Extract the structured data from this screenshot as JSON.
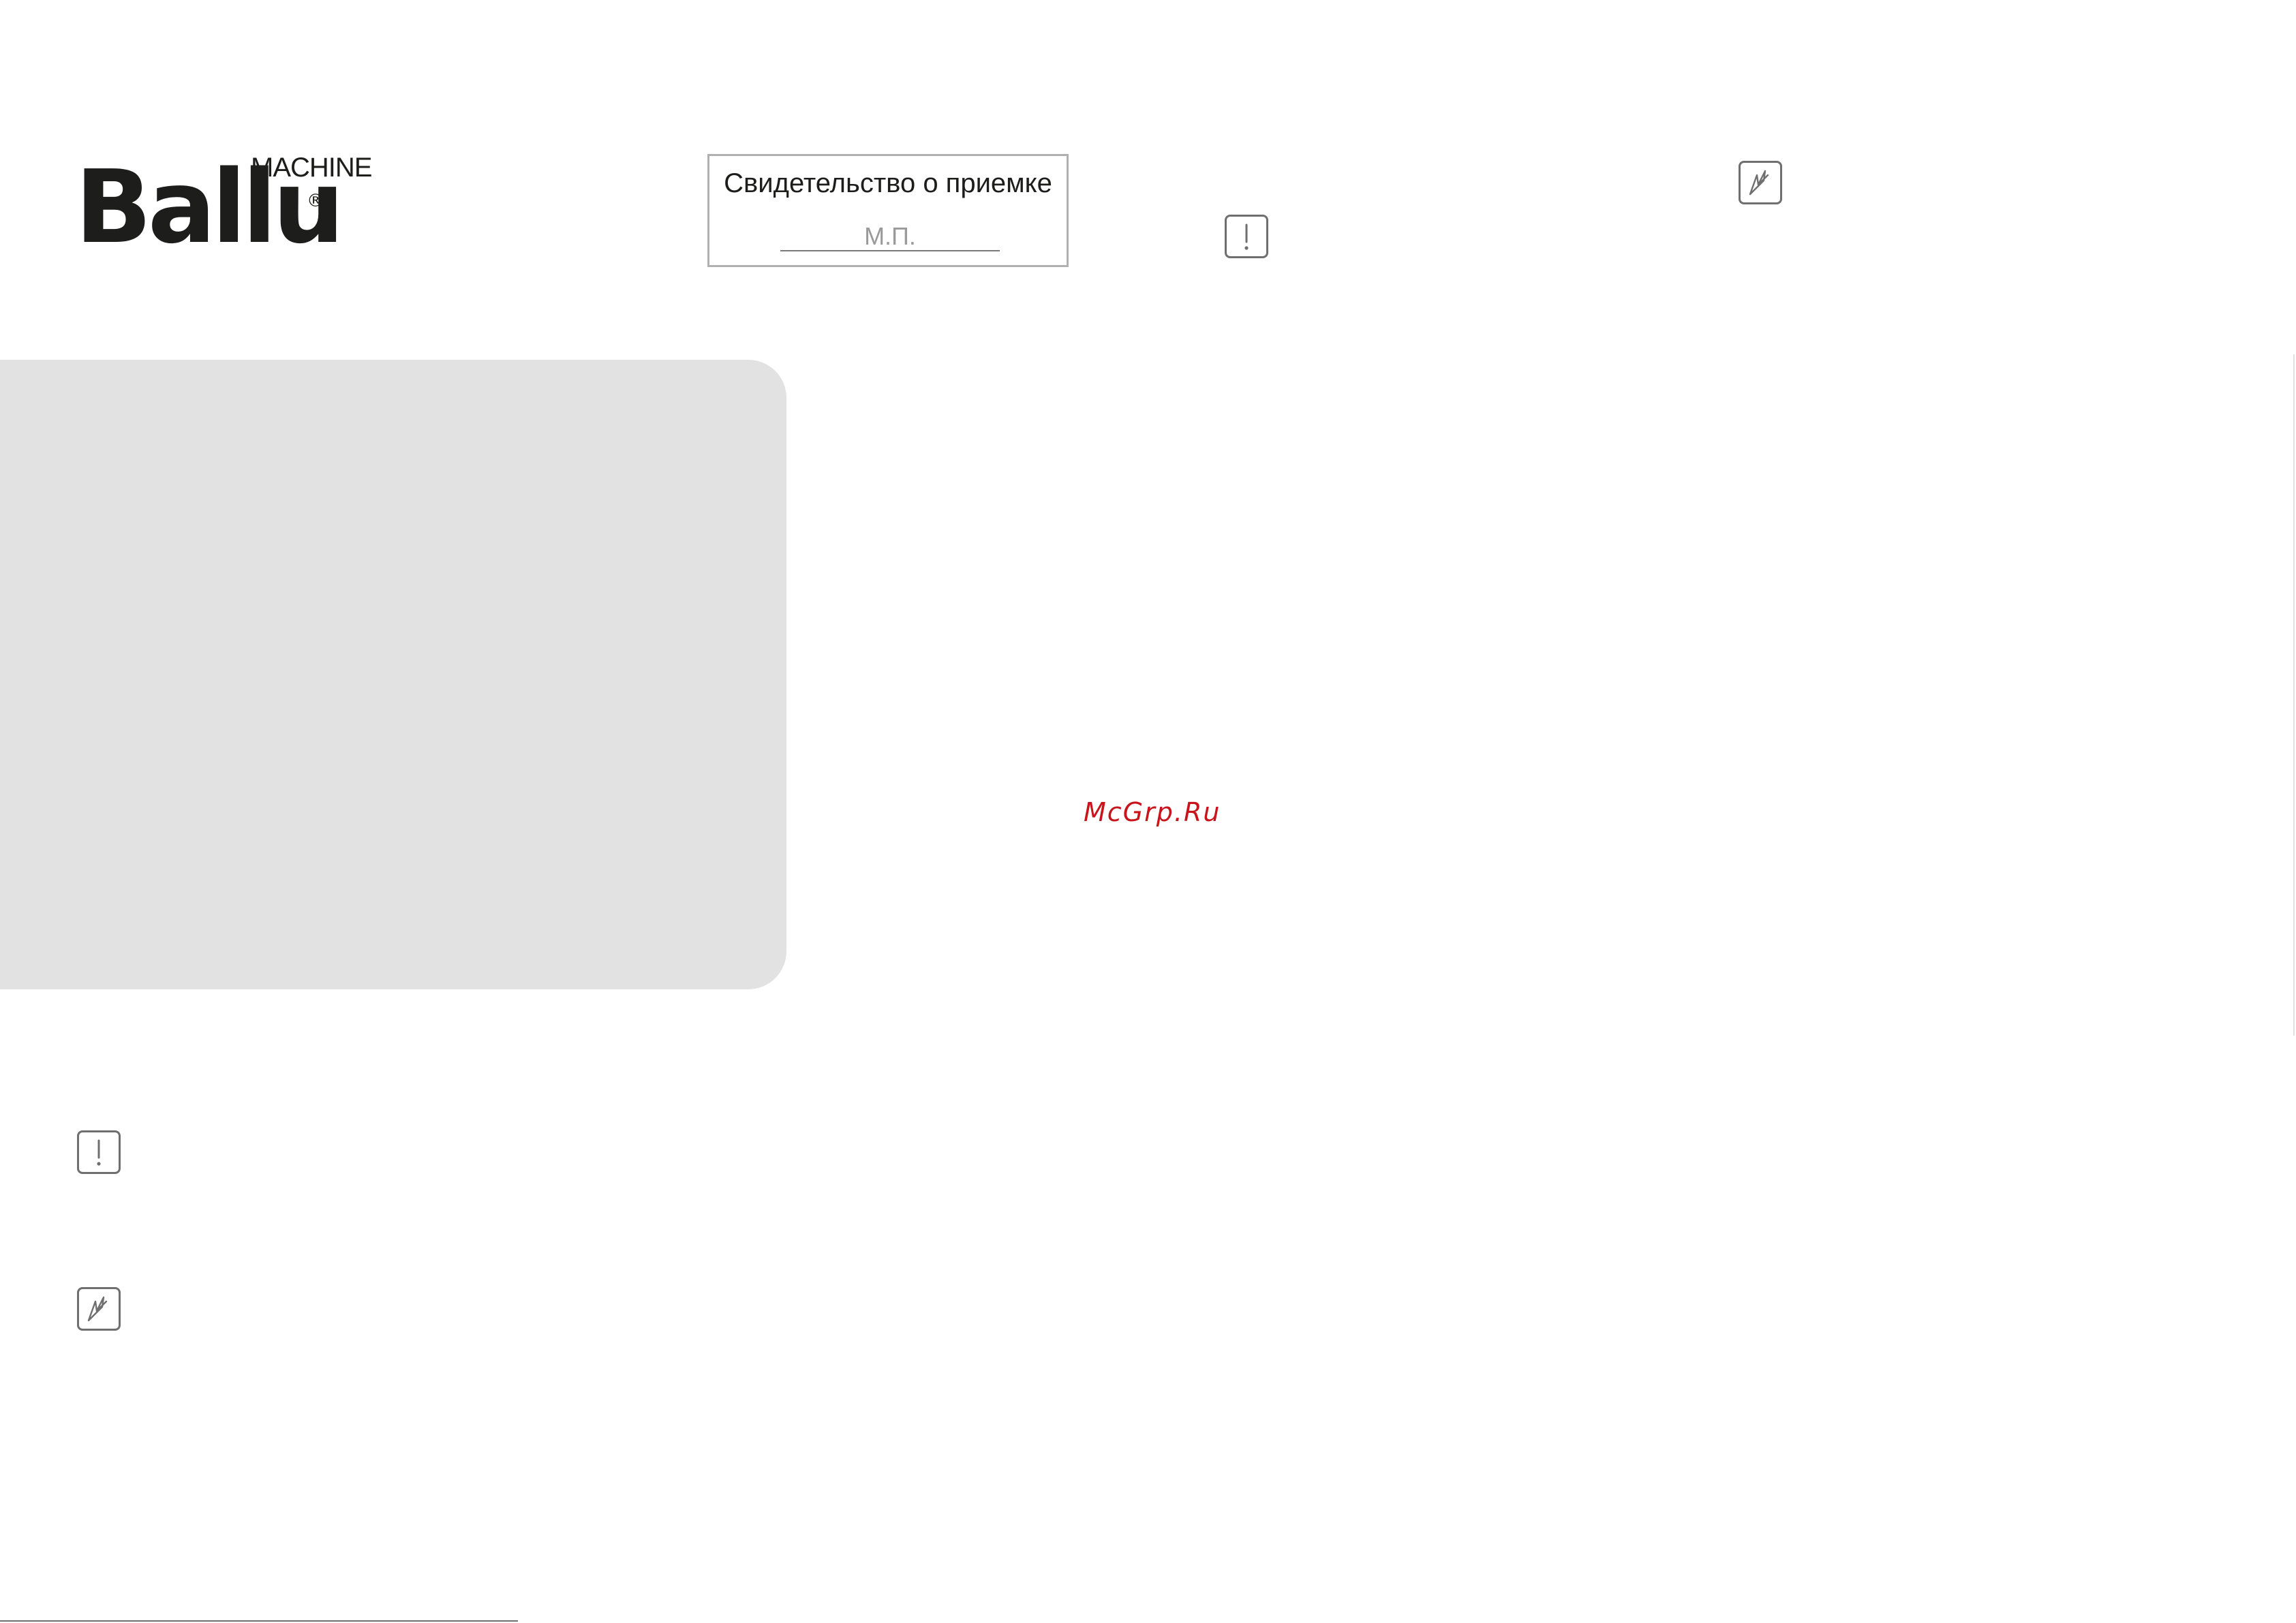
{
  "logo": {
    "brand": "Ballu",
    "sub": "MACHINE",
    "registered": "®"
  },
  "certificate": {
    "title": "Свидетельство о приемке",
    "stamp": "М.П."
  },
  "icons": {
    "warning": "warning-exclamation-icon",
    "electric": "electric-hazard-icon"
  },
  "watermark": "McGrp.Ru",
  "colors": {
    "panel": "#e1e2e1",
    "watermark": "#c8151b",
    "icon_stroke": "#6f6f6f"
  }
}
